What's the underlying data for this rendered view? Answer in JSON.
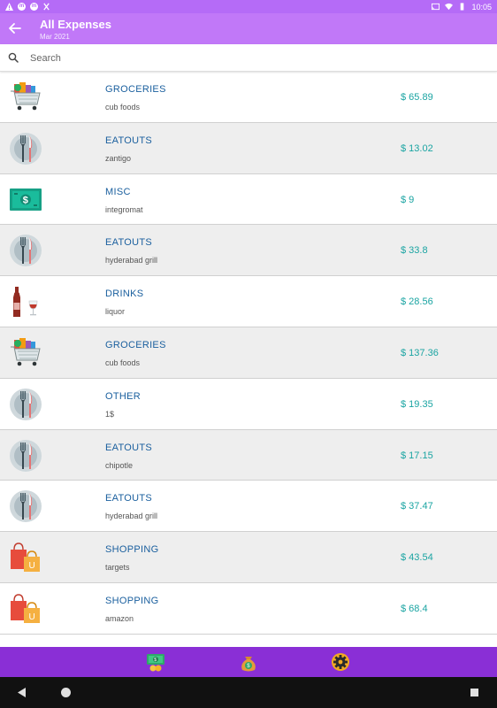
{
  "status_bar": {
    "time": "10:05",
    "notif_icons": [
      "warning-icon",
      "m-icon",
      "m-icon",
      "x-icon"
    ]
  },
  "app_bar": {
    "title": "All Expenses",
    "subtitle": "Mar 2021"
  },
  "search": {
    "placeholder": "Search"
  },
  "expenses": [
    {
      "category": "GROCERIES",
      "description": "cub foods",
      "amount": "$ 65.89",
      "icon": "grocery-cart-icon"
    },
    {
      "category": "EATOUTS",
      "description": "zantigo",
      "amount": "$ 13.02",
      "icon": "fork-knife-icon"
    },
    {
      "category": "MISC",
      "description": "integromat",
      "amount": "$ 9",
      "icon": "cash-bill-icon"
    },
    {
      "category": "EATOUTS",
      "description": "hyderabad grill",
      "amount": "$ 33.8",
      "icon": "fork-knife-icon"
    },
    {
      "category": "DRINKS",
      "description": "liquor",
      "amount": "$ 28.56",
      "icon": "wine-icon"
    },
    {
      "category": "GROCERIES",
      "description": "cub foods",
      "amount": "$ 137.36",
      "icon": "grocery-cart-icon"
    },
    {
      "category": "OTHER",
      "description": "1$",
      "amount": "$ 19.35",
      "icon": "fork-knife-icon"
    },
    {
      "category": "EATOUTS",
      "description": "chipotle",
      "amount": "$ 17.15",
      "icon": "fork-knife-icon"
    },
    {
      "category": "EATOUTS",
      "description": "hyderabad grill",
      "amount": "$ 37.47",
      "icon": "fork-knife-icon"
    },
    {
      "category": "SHOPPING",
      "description": "targets",
      "amount": "$ 43.54",
      "icon": "shopping-bags-icon"
    },
    {
      "category": "SHOPPING",
      "description": "amazon",
      "amount": "$ 68.4",
      "icon": "shopping-bags-icon"
    }
  ],
  "bottom_nav": [
    {
      "name": "expenses-nav-icon"
    },
    {
      "name": "money-bag-nav-icon"
    },
    {
      "name": "settings-gear-nav-icon"
    }
  ],
  "colors": {
    "status_bar": "#b56bf7",
    "app_bar": "#c178f8",
    "bottom_nav": "#8a2fd6",
    "category_text": "#1a5f9e",
    "amount_text": "#1aa4a2",
    "alt_row": "#eeeeee"
  }
}
